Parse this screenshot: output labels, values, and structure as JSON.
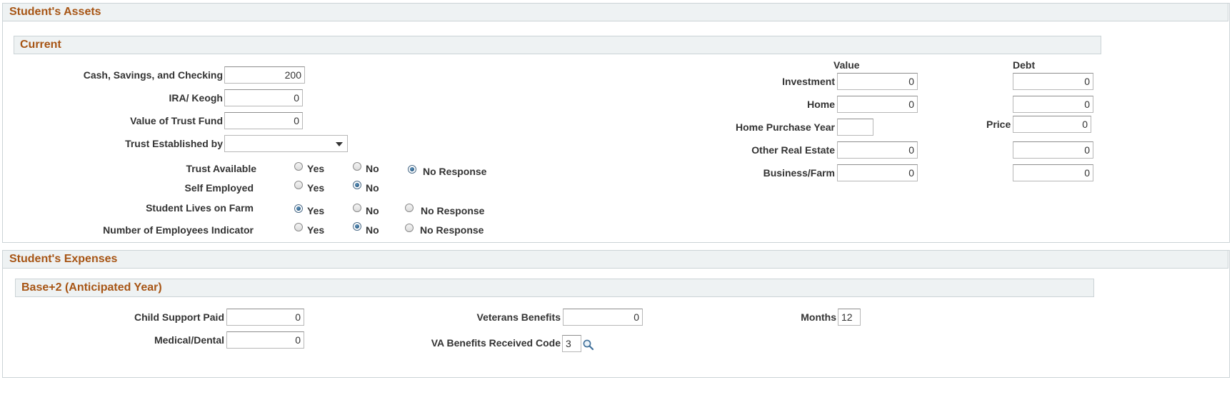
{
  "assets": {
    "title": "Student's Assets",
    "current_title": "Current",
    "cash_label": "Cash, Savings, and Checking",
    "cash_value": "200",
    "ira_label": "IRA/ Keogh",
    "ira_value": "0",
    "trust_fund_label": "Value of Trust Fund",
    "trust_fund_value": "0",
    "trust_established_label": "Trust Established by",
    "trust_established_value": "",
    "trust_available": {
      "label": "Trust Available",
      "options": [
        "Yes",
        "No",
        "No Response"
      ],
      "selected": "No Response"
    },
    "self_employed": {
      "label": "Self Employed",
      "options": [
        "Yes",
        "No"
      ],
      "selected": "No"
    },
    "lives_on_farm": {
      "label": "Student Lives on Farm",
      "options": [
        "Yes",
        "No",
        "No Response"
      ],
      "selected": "Yes"
    },
    "employees_indicator": {
      "label": "Number of Employees Indicator",
      "options": [
        "Yes",
        "No",
        "No Response"
      ],
      "selected": "No"
    },
    "value_header": "Value",
    "debt_header": "Debt",
    "investment_label": "Investment",
    "investment_value": "0",
    "investment_debt": "0",
    "home_label": "Home",
    "home_value": "0",
    "home_debt": "0",
    "home_purchase_year_label": "Home Purchase Year",
    "home_purchase_year_value": "",
    "price_label": "Price",
    "price_value": "0",
    "other_real_estate_label": "Other Real Estate",
    "other_real_estate_value": "0",
    "other_real_estate_debt": "0",
    "business_farm_label": "Business/Farm",
    "business_farm_value": "0",
    "business_farm_debt": "0"
  },
  "expenses": {
    "title": "Student's Expenses",
    "base_title": "Base+2 (Anticipated Year)",
    "child_support_label": "Child Support Paid",
    "child_support_value": "0",
    "medical_label": "Medical/Dental",
    "medical_value": "0",
    "veterans_label": "Veterans Benefits",
    "veterans_value": "0",
    "va_code_label": "VA Benefits Received Code",
    "va_code_value": "3",
    "months_label": "Months",
    "months_value": "12"
  },
  "colors": {
    "header_text": "#a75515",
    "header_bg": "#eef2f3",
    "radio_selected": "#12446e"
  },
  "icons": {
    "lookup": "magnifier-icon",
    "dropdown": "chevron-down-icon"
  }
}
